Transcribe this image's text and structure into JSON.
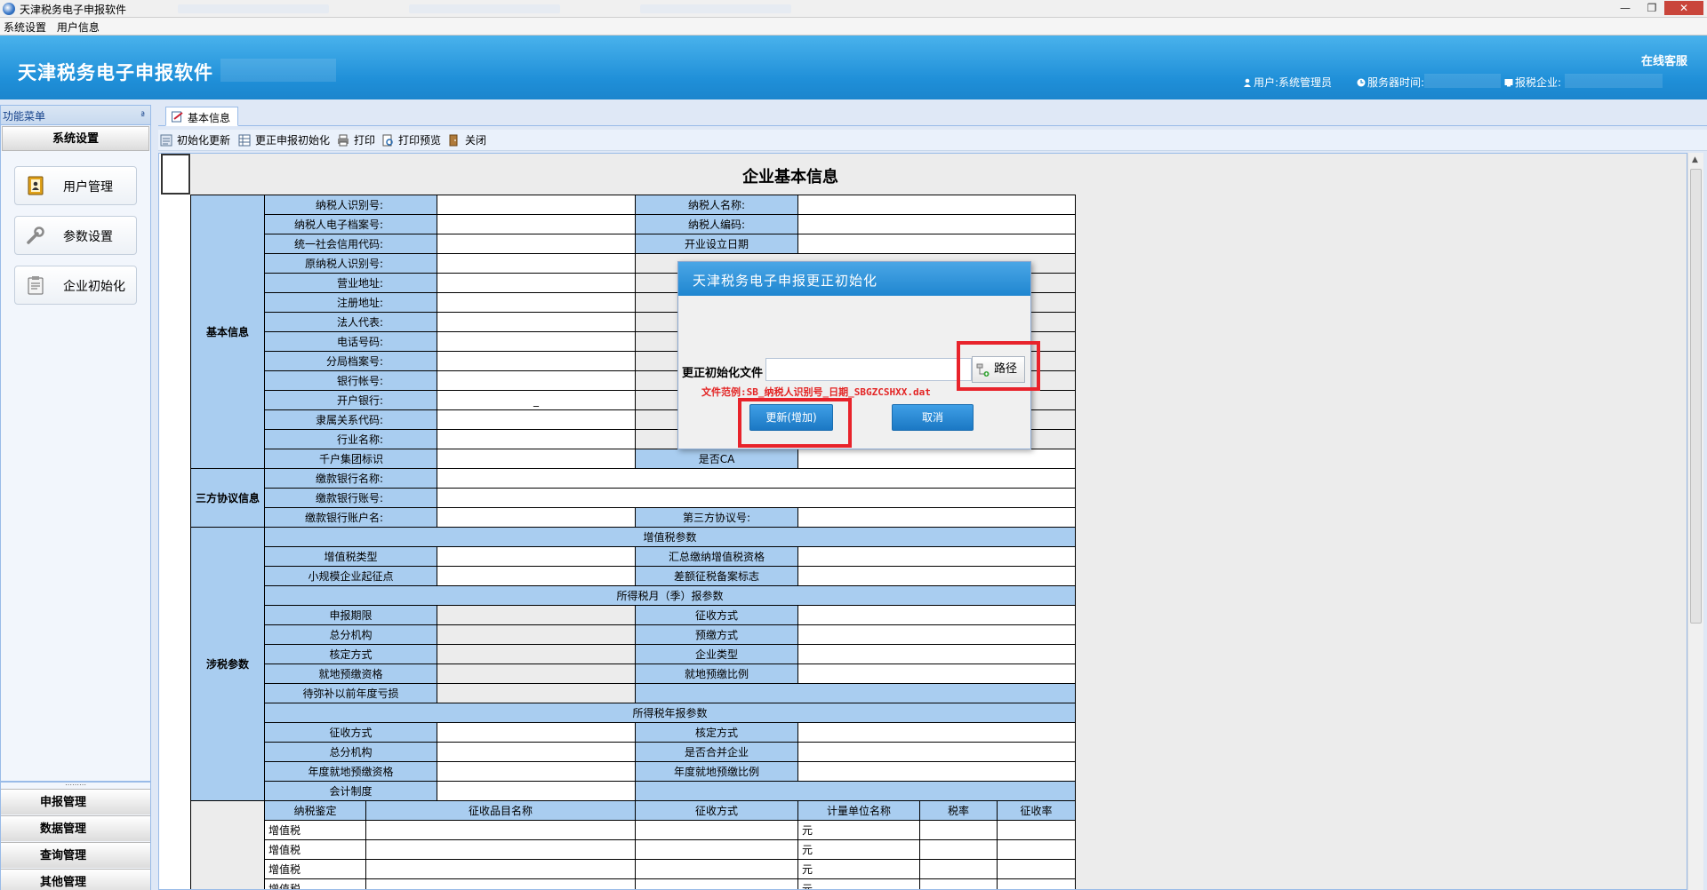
{
  "window": {
    "title": "天津税务电子申报软件",
    "minimize": "—",
    "maximize": "❐",
    "close": "✕"
  },
  "menubar": [
    "系统设置",
    "用户信息"
  ],
  "banner": {
    "app_name": "天津税务电子申报软件",
    "online_service": "在线客服",
    "user_label": "用户:系统管理员",
    "server_time_label": "服务器时间:",
    "company_label": "报税企业:"
  },
  "left_panel": {
    "header": "功能菜单",
    "pin": "ª",
    "active_section": "系统设置",
    "buttons": [
      "用户管理",
      "参数设置",
      "企业初始化"
    ],
    "grip": "⋯⋯⋯",
    "bottom_sections": [
      "申报管理",
      "数据管理",
      "查询管理",
      "其他管理"
    ]
  },
  "tab": {
    "label": "基本信息"
  },
  "toolbar": [
    "初始化更新",
    "更正申报初始化",
    "打印",
    "打印预览",
    "关闭"
  ],
  "form": {
    "title": "企业基本信息",
    "basic_section": "基本信息",
    "basic_rows": [
      [
        "纳税人识别号:",
        "纳税人名称:"
      ],
      [
        "纳税人电子档案号:",
        "纳税人编码:"
      ],
      [
        "统一社会信用代码:",
        "开业设立日期"
      ],
      [
        "原纳税人识别号:",
        ""
      ],
      [
        "营业地址:",
        ""
      ],
      [
        "注册地址:",
        ""
      ],
      [
        "法人代表:",
        ""
      ],
      [
        "电话号码:",
        ""
      ],
      [
        "分局档案号:",
        ""
      ],
      [
        "银行帐号:",
        ""
      ],
      [
        "开户银行:",
        ""
      ],
      [
        "隶属关系代码:",
        ""
      ],
      [
        "行业名称:",
        ""
      ],
      [
        "千户集团标识",
        "是否CA"
      ]
    ],
    "bank_value_mark": "_",
    "tripartite_section": "三方协议信息",
    "tripartite_rows": [
      "缴款银行名称:",
      "缴款银行账号:",
      "缴款银行账户名:"
    ],
    "tripartite_right": "第三方协议号:",
    "tax_section": "涉税参数",
    "vat_band": "增值税参数",
    "vat_rows": [
      [
        "增值税类型",
        "汇总缴纳增值税资格"
      ],
      [
        "小规模企业起征点",
        "差额征税备案标志"
      ]
    ],
    "cit_month_band": "所得税月（季）报参数",
    "cit_month_rows": [
      [
        "申报期限",
        "征收方式"
      ],
      [
        "总分机构",
        "预缴方式"
      ],
      [
        "核定方式",
        "企业类型"
      ],
      [
        "就地预缴资格",
        "就地预缴比例"
      ],
      [
        "待弥补以前年度亏损",
        ""
      ]
    ],
    "cit_year_band": "所得税年报参数",
    "cit_year_rows": [
      [
        "征收方式",
        "核定方式"
      ],
      [
        "总分机构",
        "是否合并企业"
      ],
      [
        "年度就地预缴资格",
        "年度就地预缴比例"
      ],
      [
        "会计制度",
        ""
      ]
    ],
    "item_headers": [
      "纳税鉴定",
      "征收品目名称",
      "征收方式",
      "计量单位名称",
      "税率",
      "征收率"
    ],
    "item_rows": [
      [
        "增值税",
        "元"
      ],
      [
        "增值税",
        "元"
      ],
      [
        "增值税",
        "元"
      ],
      [
        "增值税",
        "元"
      ]
    ]
  },
  "dialog": {
    "title": "天津税务电子申报更正初始化",
    "file_label": "更正初始化文件",
    "file_value": "",
    "browse_label": "路径",
    "hint": "文件范例:SB_纳税人识别号_日期_SBGZCSHXX.dat",
    "update_button": "更新(增加)",
    "cancel_button": "取消"
  }
}
